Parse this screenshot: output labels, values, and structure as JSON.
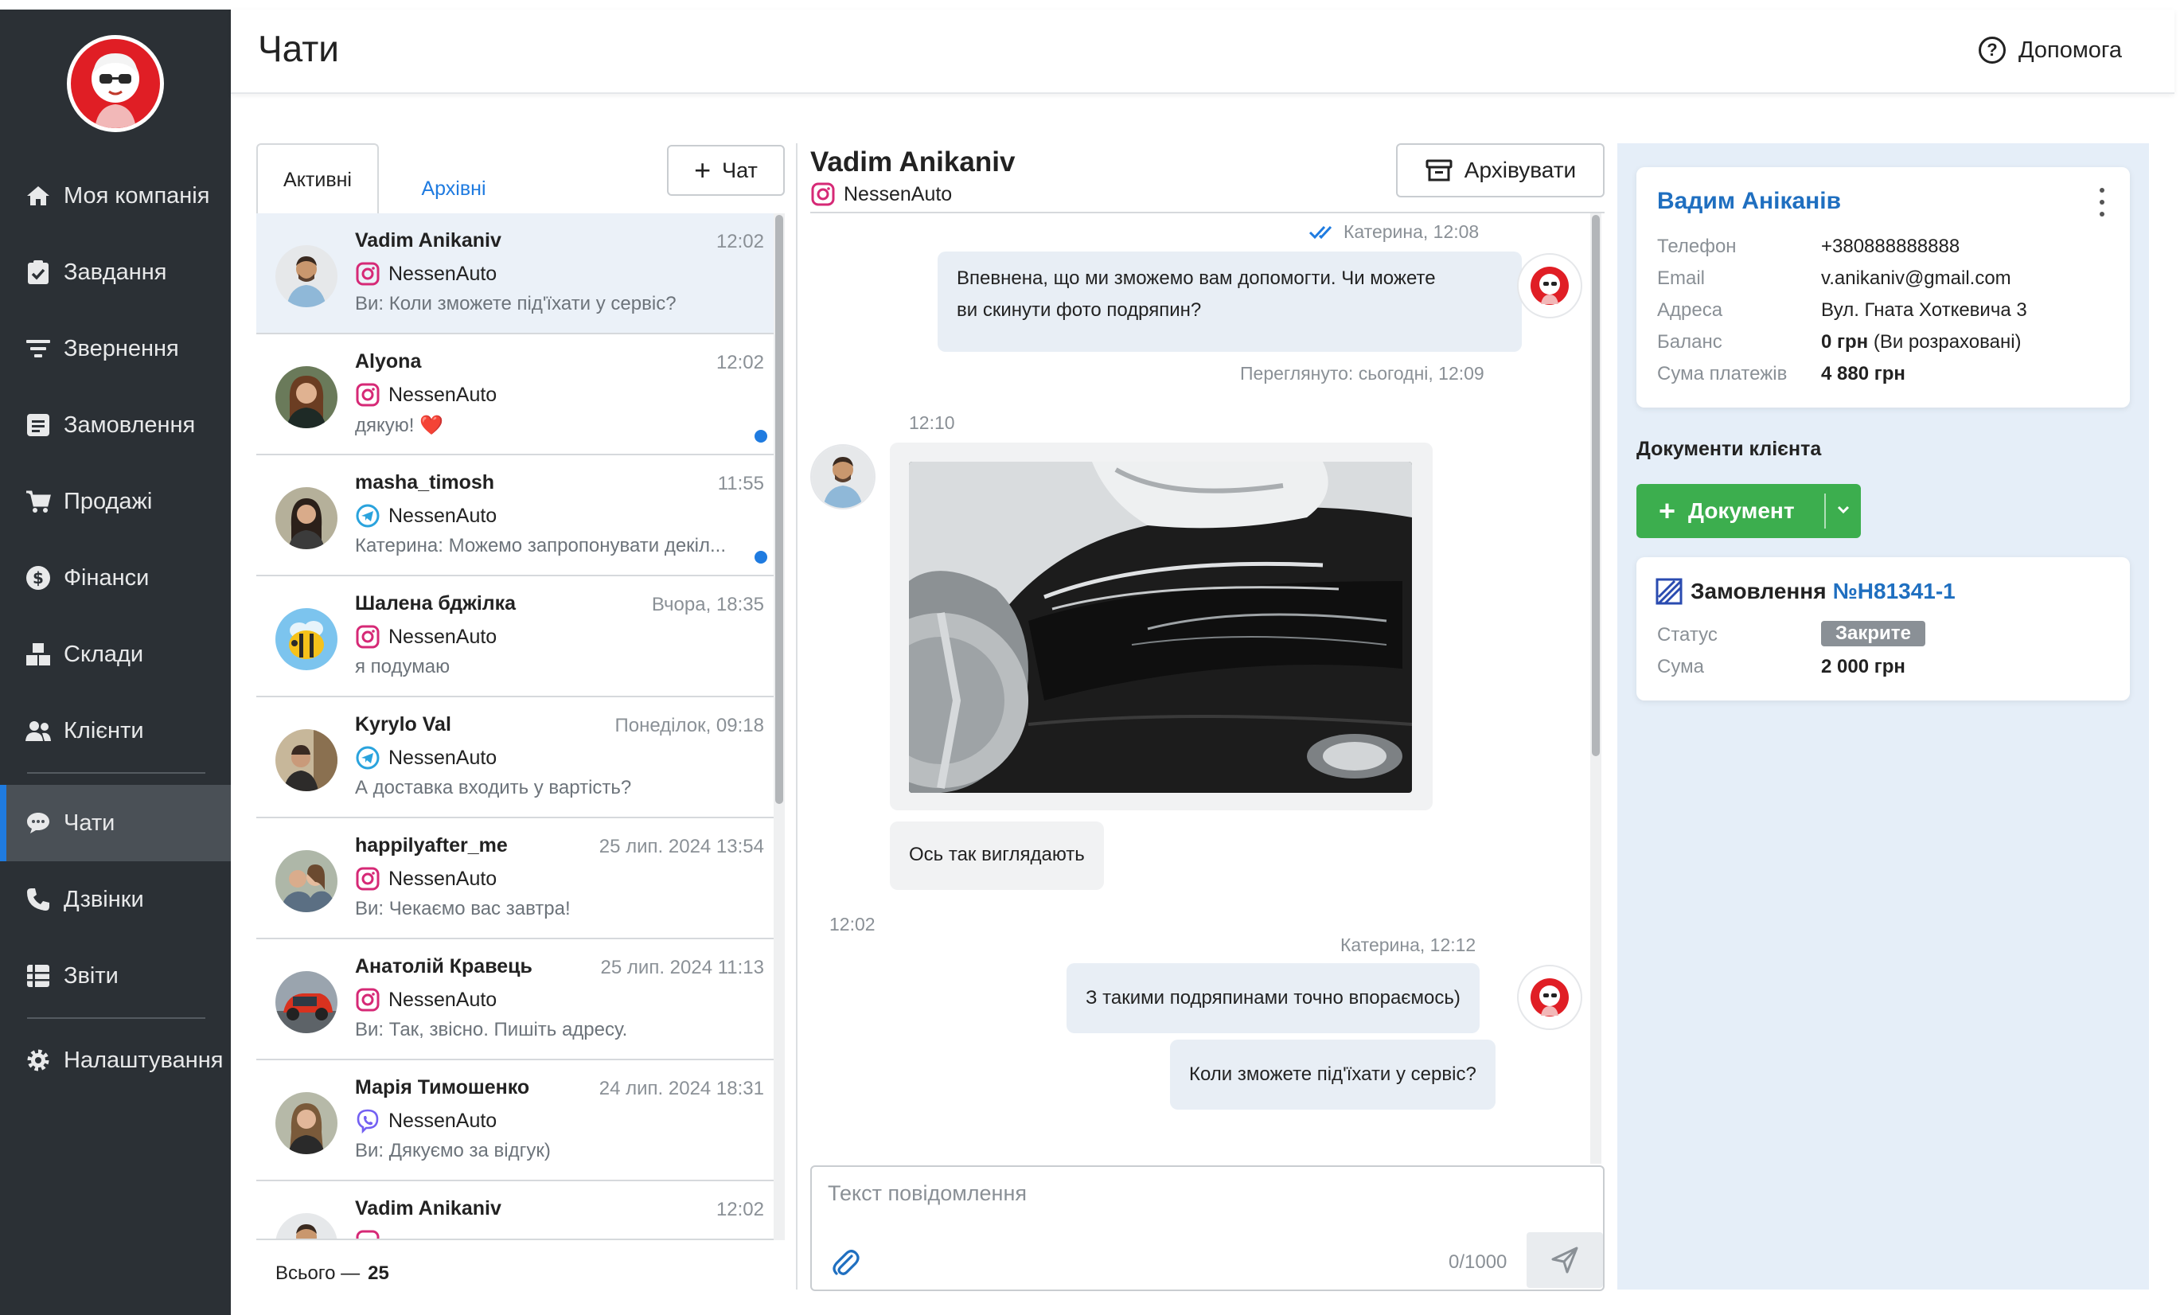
{
  "header": {
    "title": "Чати",
    "help_label": "Допомога"
  },
  "sidebar": {
    "items": [
      {
        "label": "Моя компанія",
        "icon": "home-icon"
      },
      {
        "label": "Завдання",
        "icon": "clipboard-check-icon"
      },
      {
        "label": "Звернення",
        "icon": "filter-icon"
      },
      {
        "label": "Замовлення",
        "icon": "list-box-icon"
      },
      {
        "label": "Продажі",
        "icon": "cart-icon"
      },
      {
        "label": "Фінанси",
        "icon": "dollar-circle-icon"
      },
      {
        "label": "Склади",
        "icon": "boxes-icon"
      },
      {
        "label": "Клієнти",
        "icon": "users-icon"
      },
      {
        "label": "Чати",
        "icon": "chat-bubble-icon"
      },
      {
        "label": "Дзвінки",
        "icon": "phone-icon"
      },
      {
        "label": "Звіти",
        "icon": "report-icon"
      },
      {
        "label": "Налаштування",
        "icon": "gear-icon"
      }
    ],
    "active": "Чати"
  },
  "list": {
    "tabs": [
      "Активні",
      "Архівні"
    ],
    "new_chat_label": "Чат",
    "total_label": "Всього —",
    "total_value": "25",
    "chats": [
      {
        "name": "Vadim Anikaniv",
        "time": "12:02",
        "channel": "NessenAuto",
        "channel_type": "instagram",
        "last": "Ви: Коли зможете під'їхати у сервіс?",
        "unread": false,
        "selected": true
      },
      {
        "name": "Alyona",
        "time": "12:02",
        "channel": "NessenAuto",
        "channel_type": "instagram",
        "last": "дякую! ❤️",
        "unread": true,
        "selected": false
      },
      {
        "name": "masha_timosh",
        "time": "11:55",
        "channel": "NessenAuto",
        "channel_type": "telegram",
        "last": "Катерина: Можемо запропонувати декіл...",
        "unread": true,
        "selected": false
      },
      {
        "name": "Шалена бджілка",
        "time": "Вчора, 18:35",
        "channel": "NessenAuto",
        "channel_type": "instagram",
        "last": "я подумаю",
        "unread": false,
        "selected": false
      },
      {
        "name": "Kyrylo Val",
        "time": "Понеділок, 09:18",
        "channel": "NessenAuto",
        "channel_type": "telegram",
        "last": "А доставка входить у вартість?",
        "unread": false,
        "selected": false
      },
      {
        "name": "happilyafter_me",
        "time": "25 лип. 2024 13:54",
        "channel": "NessenAuto",
        "channel_type": "instagram",
        "last": "Ви: Чекаємо вас завтра!",
        "unread": false,
        "selected": false
      },
      {
        "name": "Анатолій Кравець",
        "time": "25 лип. 2024 11:13",
        "channel": "NessenAuto",
        "channel_type": "instagram",
        "last": "Ви: Так, звісно. Пишіть адресу.",
        "unread": false,
        "selected": false
      },
      {
        "name": "Марія Тимошенко",
        "time": "24 лип. 2024 18:31",
        "channel": "NessenAuto",
        "channel_type": "viber",
        "last": "Ви: Дякуємо за відгук)",
        "unread": false,
        "selected": false
      },
      {
        "name": "Vadim Anikaniv",
        "time": "12:02",
        "channel": "",
        "channel_type": "instagram",
        "last": "",
        "unread": false,
        "selected": false
      }
    ]
  },
  "chat": {
    "name": "Vadim Anikaniv",
    "channel": "NessenAuto",
    "archive_label": "Архівувати",
    "messages": {
      "m1_meta": "Катерина, 12:08",
      "m1_text_line1": "Впевнена, що ми зможемо вам допомогти. Чи можете",
      "m1_text_line2": "ви скинути фото подряпин?",
      "m1_seen": "Переглянуто: сьогодні, 12:09",
      "m2_time": "12:10",
      "m3_text": "Ось так виглядають",
      "m4_time": "12:02",
      "m5_meta": "Катерина, 12:12",
      "m5_text": "З такими подряпинами точно впораємось)",
      "m6_text": "Коли зможете під'їхати у сервіс?"
    },
    "composer": {
      "placeholder": "Текст повідомлення",
      "counter": "0/1000"
    }
  },
  "client": {
    "name": "Вадим Аніканів",
    "fields": [
      {
        "label": "Телефон",
        "value": "+380888888888"
      },
      {
        "label": "Email",
        "value": "v.anikaniv@gmail.com"
      },
      {
        "label": "Адреса",
        "value": "Вул. Гната Хоткевича 3"
      },
      {
        "label": "Баланс",
        "value_bold": "0 грн",
        "value_rest": " (Ви розраховані)"
      },
      {
        "label": "Сума платежів",
        "value_bold": "4 880 грн"
      }
    ],
    "docs_title": "Документи клієнта",
    "doc_button": "Документ",
    "order": {
      "title": "Замовлення",
      "number": "№H81341-1",
      "status_label": "Статус",
      "status": "Закрите",
      "sum_label": "Сума",
      "sum": "2 000 грн"
    }
  },
  "colors": {
    "accent": "#1f7be0",
    "sidebar": "#2b3035",
    "green": "#3cae4e",
    "instagram": "#d62976",
    "telegram": "#2aa3dd",
    "viber": "#7360f2"
  }
}
